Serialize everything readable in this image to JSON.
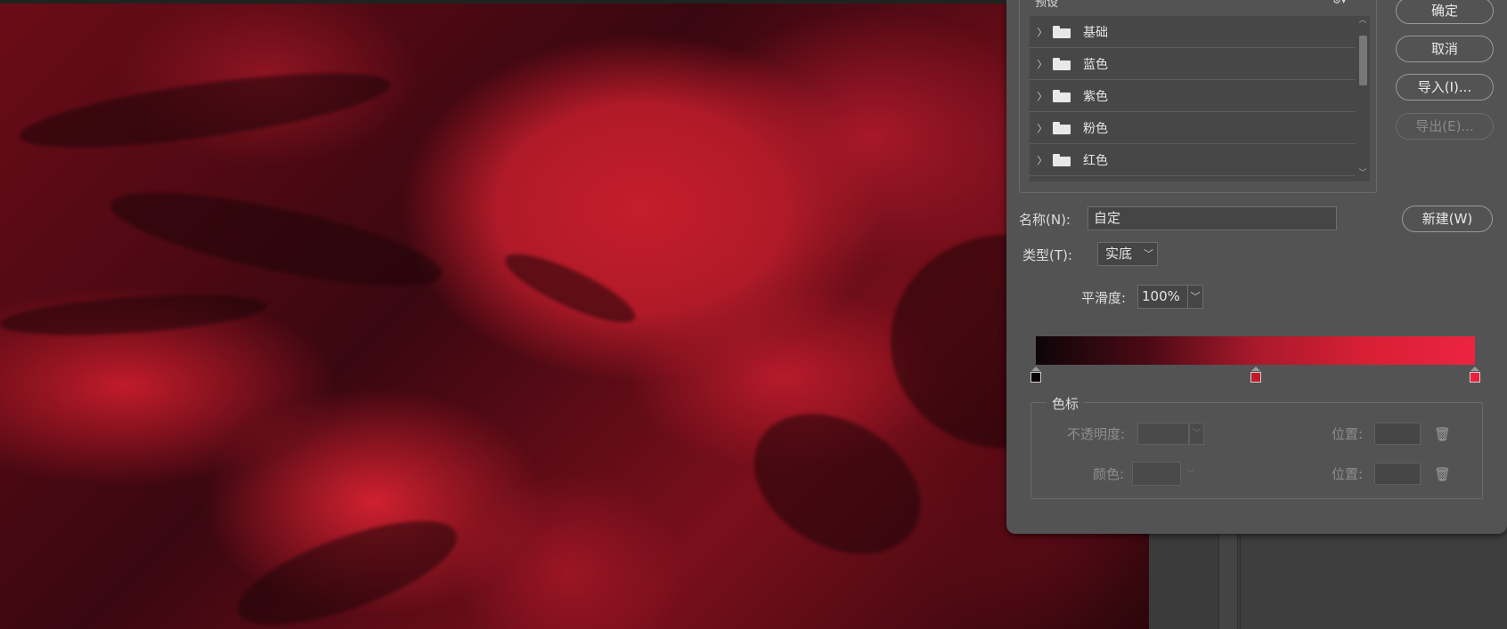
{
  "presets": {
    "title": "预设",
    "items": [
      {
        "label": "基础"
      },
      {
        "label": "蓝色"
      },
      {
        "label": "紫色"
      },
      {
        "label": "粉色"
      },
      {
        "label": "红色"
      }
    ]
  },
  "buttons": {
    "ok": "确定",
    "cancel": "取消",
    "import": "导入(I)...",
    "export": "导出(E)...",
    "new": "新建(W)"
  },
  "name": {
    "label": "名称(N):",
    "value": "自定"
  },
  "type": {
    "label": "类型(T):",
    "value": "实底"
  },
  "smoothness": {
    "label": "平滑度:",
    "value": "100%"
  },
  "gradient": {
    "colors": [
      "#0d0508",
      "#4a0a15",
      "#a8192b",
      "#d81f34",
      "#ec2440"
    ],
    "stops": [
      {
        "color": "#0a0406",
        "position": 0
      },
      {
        "color": "#c21a2c",
        "position": 0.5
      },
      {
        "color": "#e8223d",
        "position": 1
      }
    ]
  },
  "color_stops": {
    "title": "色标",
    "opacity_label": "不透明度:",
    "color_label": "颜色:",
    "position_label_1": "位置:",
    "position_label_2": "位置:"
  }
}
